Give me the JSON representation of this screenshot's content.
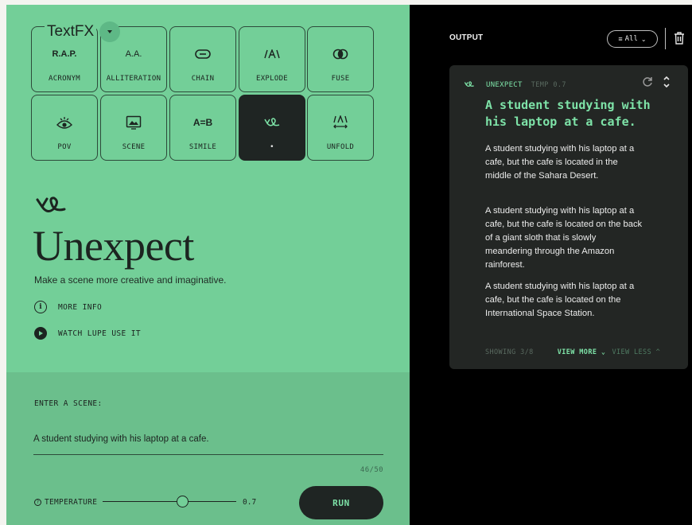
{
  "app": {
    "title": "TextFX"
  },
  "tools": [
    {
      "label": "ACRONYM",
      "glyph": "R.A.P.",
      "icon": "acronym-icon"
    },
    {
      "label": "ALLITERATION",
      "glyph": "A.A.",
      "icon": "alliteration-icon"
    },
    {
      "label": "CHAIN",
      "glyph": "",
      "icon": "chain-link-icon"
    },
    {
      "label": "EXPLODE",
      "glyph": "",
      "icon": "explode-icon"
    },
    {
      "label": "FUSE",
      "glyph": "",
      "icon": "fuse-icon"
    },
    {
      "label": "POV",
      "glyph": "",
      "icon": "eye-icon"
    },
    {
      "label": "SCENE",
      "glyph": "",
      "icon": "image-icon"
    },
    {
      "label": "SIMILE",
      "glyph": "A=B",
      "icon": "equals-icon"
    },
    {
      "label": "•",
      "glyph": "",
      "icon": "unexpect-icon",
      "active": true
    },
    {
      "label": "UNFOLD",
      "glyph": "",
      "icon": "unfold-icon"
    }
  ],
  "hero": {
    "title": "Unexpect",
    "description": "Make a scene more creative and imaginative.",
    "more_info": "MORE INFO",
    "watch": "WATCH LUPE USE IT"
  },
  "input": {
    "label": "ENTER A SCENE:",
    "value": "A student studying with his laptop at a cafe.",
    "counter": "46/50"
  },
  "temperature": {
    "label": "TEMPERATURE",
    "value": "0.7",
    "level": 0.6
  },
  "run_label": "RUN",
  "output": {
    "title": "OUTPUT",
    "filter": "All",
    "card": {
      "tool": "UNEXPECT",
      "temp": "TEMP 0.7",
      "prompt": "A student studying with his laptop at a cafe.",
      "responses": [
        "A student studying with his laptop at a cafe, but the cafe is located in the middle of the Sahara Desert.",
        "A student studying with his laptop at a cafe, but the cafe is located on the back of a giant sloth that is slowly meandering through the Amazon rainforest.",
        "A student studying with his laptop at a cafe, but the cafe is located on the International Space Station."
      ],
      "showing": "SHOWING 3/8",
      "view_more": "VIEW MORE",
      "view_less": "VIEW LESS"
    }
  },
  "colors": {
    "left_bg": "#73cf98",
    "left_bottom_bg": "#6bbf8c",
    "dark": "#1f2523",
    "accent": "#7ee3a8"
  }
}
